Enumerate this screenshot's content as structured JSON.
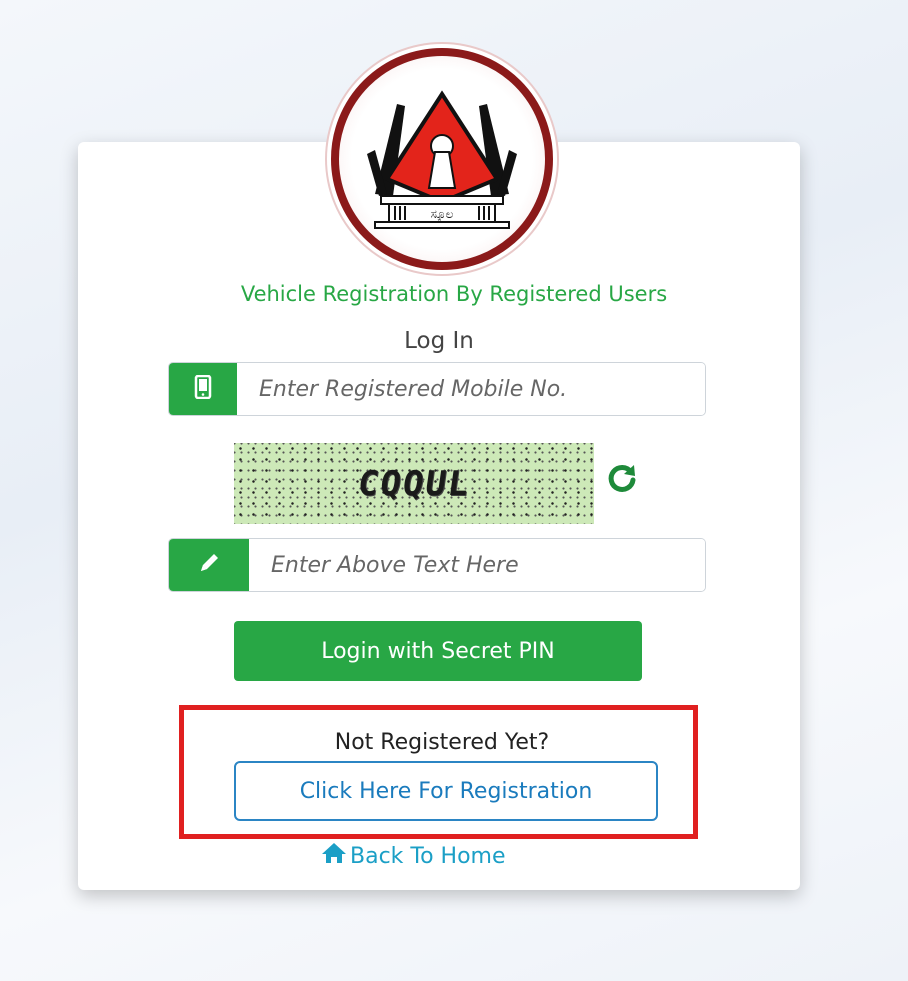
{
  "subtitle": "Vehicle Registration By Registered Users",
  "login_title": "Log In",
  "mobile": {
    "placeholder": "Enter Registered Mobile No.",
    "icon": "mobile-phone-icon"
  },
  "captcha": {
    "text": "CQQUL",
    "refresh_icon": "refresh-icon",
    "placeholder": "Enter Above Text Here",
    "input_icon": "pencil-icon"
  },
  "login_button": "Login with Secret PIN",
  "registration": {
    "prompt": "Not Registered Yet?",
    "button": "Click Here For Registration"
  },
  "back_home": {
    "label": "Back To Home",
    "icon": "home-icon"
  },
  "logo": {
    "text": "ಸ್ಕೂಲ",
    "icon": "organization-logo"
  },
  "colors": {
    "accent_green": "#28a745",
    "link_blue": "#1a7bbd",
    "highlight_red": "#e02020",
    "logo_ring": "#8b1a1a"
  }
}
